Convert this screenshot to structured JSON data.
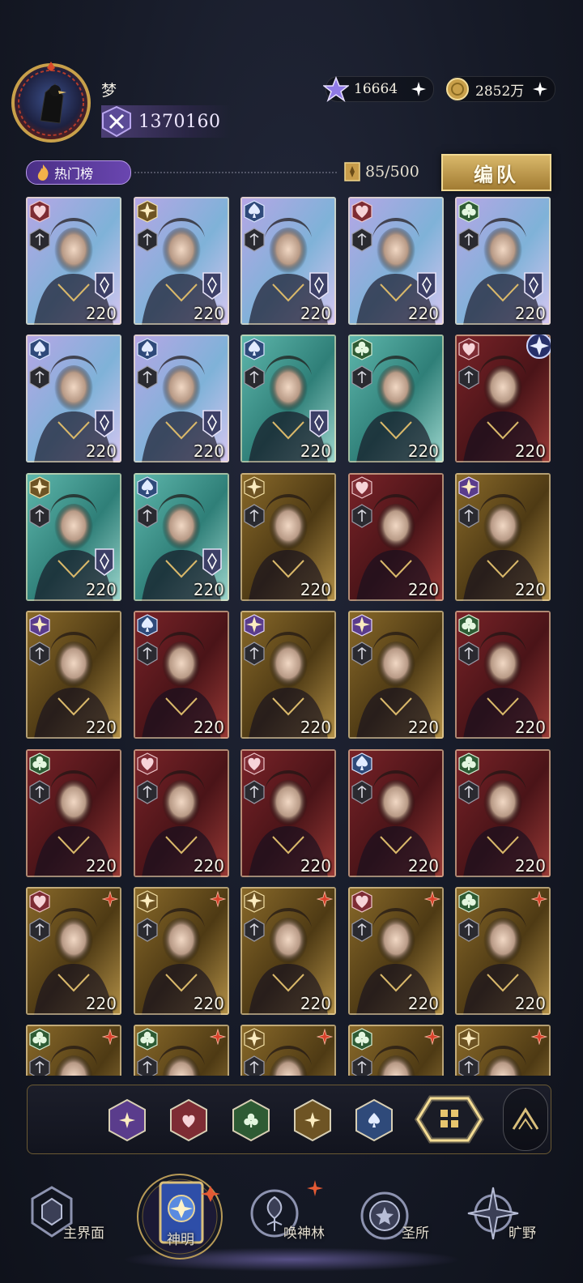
{
  "player": {
    "name": "梦",
    "power": "1370160"
  },
  "currency": {
    "gems": {
      "value": "16664",
      "icon": "purple-star-gem-icon"
    },
    "coins": {
      "value": "2852万",
      "icon": "gold-coin-icon"
    }
  },
  "ranking": {
    "label": "热门榜"
  },
  "capacity": {
    "value": "85/500"
  },
  "team_button": {
    "label": "编队"
  },
  "cards": [
    {
      "suit": "heart",
      "level": "220",
      "bg": "holo",
      "badge": true
    },
    {
      "suit": "star",
      "level": "220",
      "bg": "holo",
      "badge": true
    },
    {
      "suit": "spade",
      "level": "220",
      "bg": "holo",
      "badge": true
    },
    {
      "suit": "heart",
      "level": "220",
      "bg": "holo",
      "badge": true
    },
    {
      "suit": "club",
      "level": "220",
      "bg": "holo",
      "badge": true
    },
    {
      "suit": "spade",
      "level": "220",
      "bg": "holo",
      "badge": true
    },
    {
      "suit": "spade",
      "level": "220",
      "bg": "holo",
      "badge": true
    },
    {
      "suit": "spade",
      "level": "220",
      "bg": "teal",
      "badge": true
    },
    {
      "suit": "club",
      "level": "220",
      "bg": "teal",
      "badge": false
    },
    {
      "suit": "heart",
      "level": "220",
      "bg": "red",
      "badge": false,
      "orb": true
    },
    {
      "suit": "star",
      "level": "220",
      "bg": "teal",
      "badge": true
    },
    {
      "suit": "spade",
      "level": "220",
      "bg": "teal",
      "badge": true
    },
    {
      "suit": "star",
      "level": "220",
      "bg": "gold",
      "badge": false
    },
    {
      "suit": "heart",
      "level": "220",
      "bg": "red",
      "badge": false
    },
    {
      "suit": "starpurple",
      "level": "220",
      "bg": "gold",
      "badge": false
    },
    {
      "suit": "starpurple",
      "level": "220",
      "bg": "gold",
      "badge": false
    },
    {
      "suit": "spade",
      "level": "220",
      "bg": "red",
      "badge": false
    },
    {
      "suit": "starpurple",
      "level": "220",
      "bg": "gold",
      "badge": false
    },
    {
      "suit": "starpurple",
      "level": "220",
      "bg": "gold",
      "badge": false
    },
    {
      "suit": "club",
      "level": "220",
      "bg": "red",
      "badge": false
    },
    {
      "suit": "club",
      "level": "220",
      "bg": "red",
      "badge": false
    },
    {
      "suit": "heart",
      "level": "220",
      "bg": "red",
      "badge": false
    },
    {
      "suit": "heart",
      "level": "220",
      "bg": "red",
      "badge": false
    },
    {
      "suit": "spade",
      "level": "220",
      "bg": "red",
      "badge": false
    },
    {
      "suit": "club",
      "level": "220",
      "bg": "red",
      "badge": false
    },
    {
      "suit": "heart",
      "level": "220",
      "bg": "gold",
      "badge": false,
      "redstar": true
    },
    {
      "suit": "star",
      "level": "220",
      "bg": "gold",
      "badge": false,
      "redstar": true
    },
    {
      "suit": "star",
      "level": "220",
      "bg": "gold",
      "badge": false,
      "redstar": true
    },
    {
      "suit": "heart",
      "level": "220",
      "bg": "gold",
      "badge": false,
      "redstar": true
    },
    {
      "suit": "club",
      "level": "220",
      "bg": "gold",
      "badge": false,
      "redstar": true
    },
    {
      "suit": "club",
      "level": "",
      "bg": "gold",
      "badge": false,
      "redstar": true
    },
    {
      "suit": "club",
      "level": "",
      "bg": "gold",
      "badge": false,
      "redstar": true
    },
    {
      "suit": "star",
      "level": "",
      "bg": "gold",
      "badge": false,
      "redstar": true
    },
    {
      "suit": "club",
      "level": "",
      "bg": "gold",
      "badge": false,
      "redstar": true
    },
    {
      "suit": "star",
      "level": "",
      "bg": "gold",
      "badge": false,
      "redstar": true
    }
  ],
  "filters": [
    {
      "name": "star-purple",
      "icon": "purple-star-filter-icon",
      "color": "#5a3c8c"
    },
    {
      "name": "heart",
      "icon": "heart-filter-icon",
      "color": "#7e2c34"
    },
    {
      "name": "club",
      "icon": "club-filter-icon",
      "color": "#2e5b34"
    },
    {
      "name": "star-gold",
      "icon": "gold-star-filter-icon",
      "color": "#6e5424"
    },
    {
      "name": "spade",
      "icon": "spade-filter-icon",
      "color": "#2f4a7a"
    }
  ],
  "filter_all": {
    "icon": "all-filter-icon"
  },
  "nav": [
    {
      "label": "主界面",
      "icon": "main-world-icon"
    },
    {
      "label": "神明",
      "icon": "gods-book-icon",
      "active": true
    },
    {
      "label": "唤神林",
      "icon": "summon-tree-icon"
    },
    {
      "label": "圣所",
      "icon": "sanctuary-icon"
    },
    {
      "label": "旷野",
      "icon": "wilderness-compass-icon"
    }
  ],
  "colors": {
    "accent_gold": "#d9b86a",
    "accent_purple": "#6a46b0",
    "background": "#161a27"
  }
}
